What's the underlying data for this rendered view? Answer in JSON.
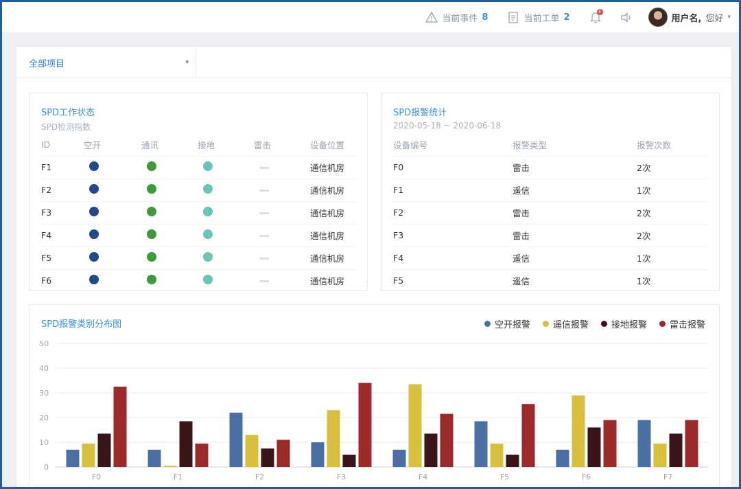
{
  "topbar": {
    "events_label": "当前事件",
    "events_count": "8",
    "workorders_label": "当前工单",
    "workorders_count": "2",
    "bell_badge": "8",
    "username": "用户名,",
    "greeting": "您好"
  },
  "filter": {
    "project_select": "全部项目"
  },
  "status_card": {
    "title": "SPD工作状态",
    "subtitle": "SPD检测指数",
    "headers": [
      "ID",
      "空开",
      "通讯",
      "接地",
      "雷击",
      "设备位置"
    ],
    "rows": [
      {
        "id": "F1",
        "location": "通信机房"
      },
      {
        "id": "F2",
        "location": "通信机房"
      },
      {
        "id": "F3",
        "location": "通信机房"
      },
      {
        "id": "F4",
        "location": "通信机房"
      },
      {
        "id": "F5",
        "location": "通信机房"
      },
      {
        "id": "F6",
        "location": "通信机房"
      }
    ],
    "colors": {
      "breaker": "#1f4a8c",
      "comm": "#3f9a3c",
      "ground": "#6cc4b9"
    }
  },
  "alarm_card": {
    "title": "SPD报警统计",
    "date_range": "2020-05-18 ~ 2020-06-18",
    "headers": [
      "设备编号",
      "报警类型",
      "报警次数"
    ],
    "rows": [
      {
        "device": "F0",
        "type": "雷击",
        "count": "2次"
      },
      {
        "device": "F1",
        "type": "遥信",
        "count": "1次"
      },
      {
        "device": "F2",
        "type": "雷击",
        "count": "2次"
      },
      {
        "device": "F3",
        "type": "雷击",
        "count": "2次"
      },
      {
        "device": "F4",
        "type": "遥信",
        "count": "1次"
      },
      {
        "device": "F5",
        "type": "遥信",
        "count": "1次"
      }
    ]
  },
  "chart_card": {
    "title": "SPD报警类别分布图"
  },
  "chart_data": {
    "type": "bar",
    "categories": [
      "F0",
      "F1",
      "F2",
      "F3",
      "F4",
      "F5",
      "F6",
      "F7"
    ],
    "ylim": [
      0,
      50
    ],
    "yticks": [
      0,
      10,
      20,
      30,
      40,
      50
    ],
    "grid": true,
    "legend": "top-right",
    "series": [
      {
        "name": "空开报警",
        "color": "#4a6fa5",
        "values": [
          7,
          7,
          22,
          10,
          7,
          18.5,
          7,
          19
        ]
      },
      {
        "name": "遥信报警",
        "color": "#d9bf3e",
        "values": [
          9.5,
          0.5,
          13,
          23,
          33.5,
          9.5,
          29,
          9.5
        ]
      },
      {
        "name": "接地报警",
        "color": "#3a1518",
        "values": [
          13.5,
          18.5,
          7.5,
          5,
          13.5,
          5,
          16,
          13.5
        ]
      },
      {
        "name": "雷击报警",
        "color": "#9c2a2a",
        "values": [
          32.5,
          9.5,
          11,
          34,
          21.5,
          25.5,
          19,
          19
        ]
      }
    ]
  }
}
